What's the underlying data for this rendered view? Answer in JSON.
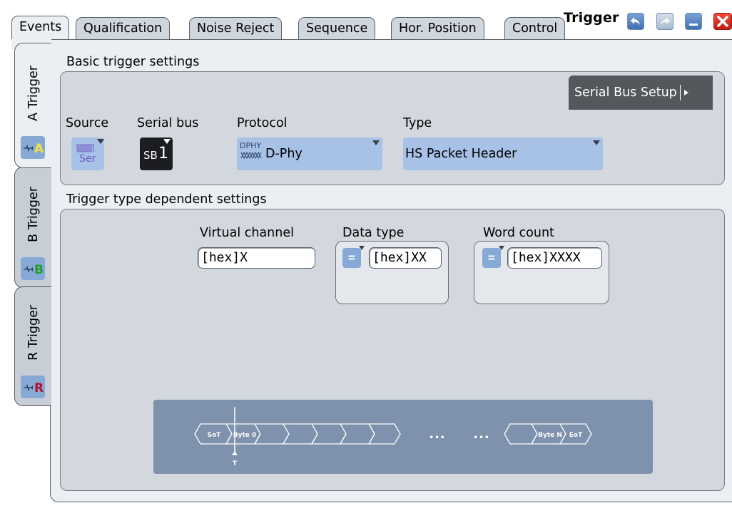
{
  "title": "Trigger",
  "tabs": [
    "Events",
    "Qualification",
    "Noise Reject",
    "Sequence",
    "Hor. Position",
    "Control"
  ],
  "side_tabs": [
    {
      "label": "A Trigger",
      "icon_letter": "A"
    },
    {
      "label": "B Trigger",
      "icon_letter": "B"
    },
    {
      "label": "R Trigger",
      "icon_letter": "R"
    }
  ],
  "basic": {
    "group_label": "Basic trigger settings",
    "serial_bus_setup": "Serial Bus Setup",
    "source_label": "Source",
    "source_value": "Ser",
    "serial_bus_label": "Serial bus",
    "serial_bus_value_prefix": "SB",
    "serial_bus_value_num": "1",
    "protocol_label": "Protocol",
    "protocol_icon_text": "DPHY",
    "protocol_value": "D-Phy",
    "type_label": "Type",
    "type_value": "HS Packet Header"
  },
  "dependent": {
    "group_label": "Trigger type dependent settings",
    "virtual_channel_label": "Virtual channel",
    "virtual_channel_value": "[hex]X",
    "data_type_label": "Data type",
    "data_type_operator": "=",
    "data_type_value": "[hex]XX",
    "word_count_label": "Word count",
    "word_count_operator": "=",
    "word_count_value": "[hex]XXXX"
  },
  "diagram": {
    "sot": "SoT",
    "byte0": "Byte 0",
    "ellipsis1": "...",
    "ellipsis2": "...",
    "byten": "Byte N",
    "eot": "EoT",
    "trigger_marker": "T"
  },
  "colors": {
    "tab_active": "#ebeff3",
    "tab_inactive": "#cfd6de",
    "dropdown": "#a8c1e6",
    "setup_button": "#54575b",
    "diagram_bg": "#7e91ad",
    "close": "#e0281c"
  }
}
